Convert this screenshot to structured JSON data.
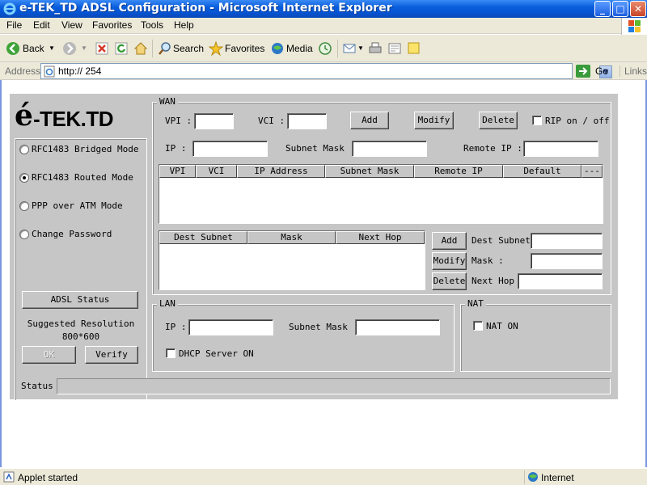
{
  "window": {
    "title": "e-TEK_TD ADSL Configuration - Microsoft Internet Explorer",
    "minimize": "_",
    "maximize": "□",
    "close": "✕"
  },
  "menu": [
    "File",
    "Edit",
    "View",
    "Favorites",
    "Tools",
    "Help"
  ],
  "toolbar": {
    "back": "Back",
    "search": "Search",
    "favorites": "Favorites",
    "media": "Media"
  },
  "address": {
    "label": "Address",
    "url": "http://            254",
    "go": "Go",
    "links": "Links"
  },
  "applet": {
    "logo_e": "é",
    "logo_text": "-TEK.TD",
    "modes": [
      {
        "label": "RFC1483 Bridged Mode",
        "selected": false
      },
      {
        "label": "RFC1483 Routed Mode",
        "selected": true
      },
      {
        "label": "PPP over ATM Mode",
        "selected": false
      },
      {
        "label": "Change Password",
        "selected": false
      }
    ],
    "adsl_status_button": "ADSL Status",
    "suggested_label": "Suggested Resolution",
    "suggested_value": "800*600",
    "ok_button": "OK",
    "verify_button": "Verify",
    "status_label": "Status",
    "status_value": ""
  },
  "wan": {
    "title": "WAN",
    "vpi_label": "VPI :",
    "vpi_value": "",
    "vci_label": "VCI :",
    "vci_value": "",
    "add": "Add",
    "modify": "Modify",
    "delete": "Delete",
    "rip_label": "RIP on / off",
    "rip_checked": false,
    "ip_label": "IP :",
    "ip_value": "",
    "subnet_label": "Subnet Mask :",
    "subnet_value": "",
    "remote_label": "Remote IP :",
    "remote_value": "",
    "table_columns": [
      "VPI",
      "VCI",
      "IP   Address",
      "Subnet   Mask",
      "Remote   IP",
      "Default Gateway",
      "---"
    ],
    "route_columns": [
      "Dest Subnet",
      "Mask",
      "Next Hop"
    ],
    "route_add": "Add",
    "route_modify": "Modify",
    "route_delete": "Delete",
    "dest_subnet_label": "Dest Subnet",
    "dest_subnet_value": "",
    "mask_label": "Mask :",
    "mask_value": "",
    "next_hop_label": "Next Hop",
    "next_hop_value": ""
  },
  "lan": {
    "title": "LAN",
    "ip_label": "IP :",
    "ip_value": "",
    "subnet_label": "Subnet Mask :",
    "subnet_value": "",
    "dhcp_label": "DHCP Server ON",
    "dhcp_checked": false
  },
  "nat": {
    "title": "NAT",
    "nat_label": "NAT ON",
    "nat_checked": false
  },
  "statusbar": {
    "message": "Applet started",
    "zone": "Internet"
  }
}
